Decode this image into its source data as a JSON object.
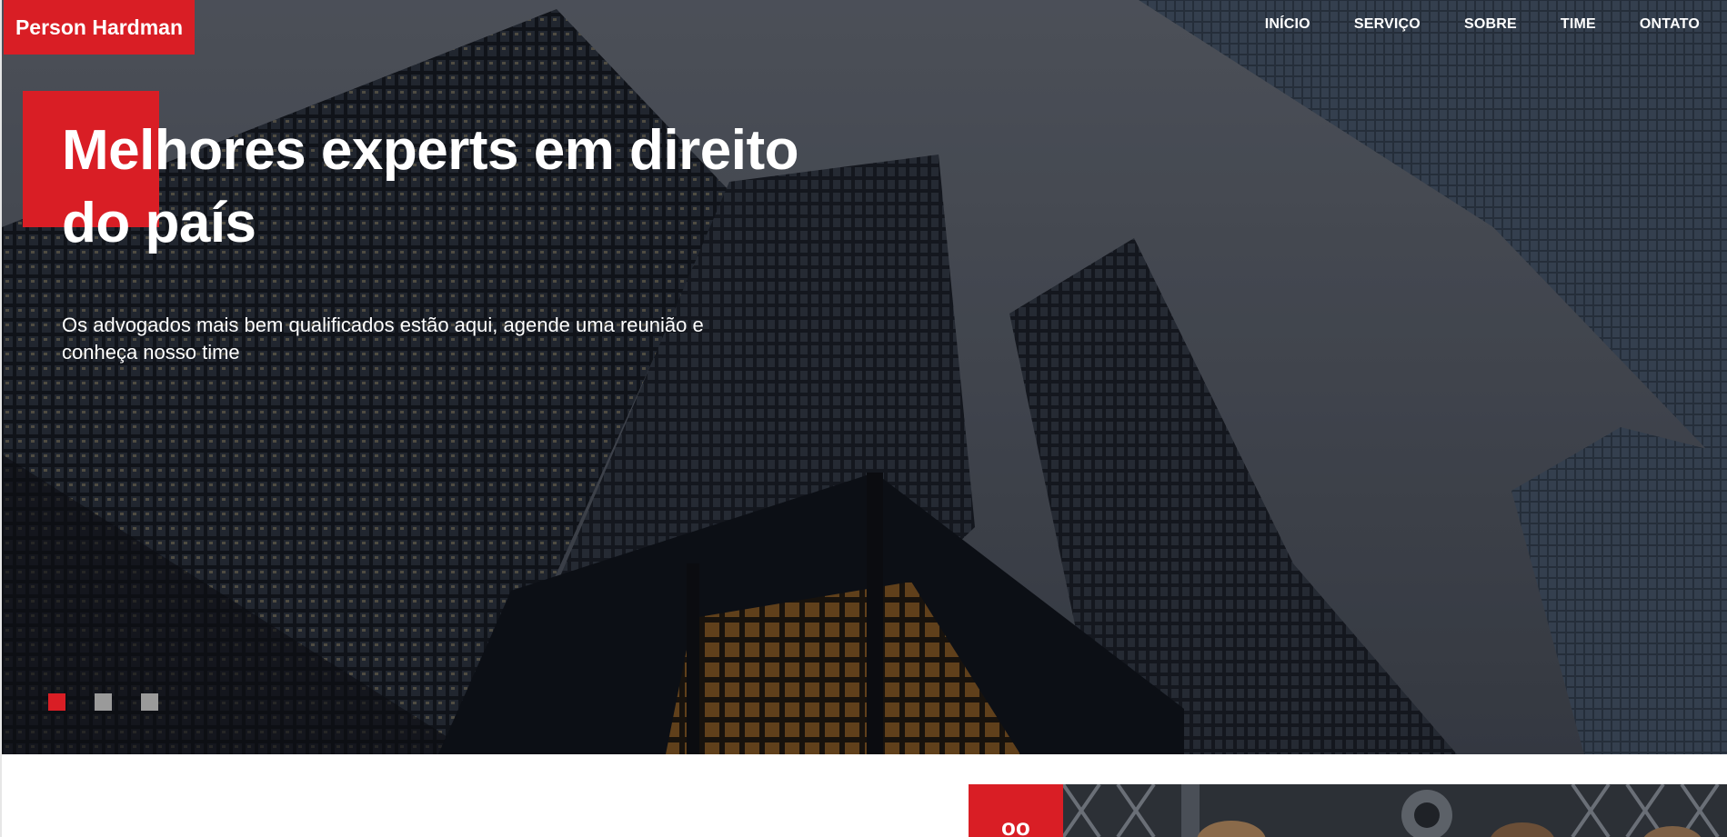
{
  "header": {
    "brand": "Person Hardman",
    "nav": [
      "INÍCIO",
      "SERVIÇO",
      "SOBRE",
      "TIME",
      "ONTATO"
    ]
  },
  "hero": {
    "headline": "Melhores experts em direito do país",
    "subtitle": "Os advogados mais bem qualificados estão aqui, agende uma reunião e conheça nosso time",
    "slides": {
      "count": 3,
      "active_index": 0
    }
  },
  "section": {
    "badge_icon": "quote-icon",
    "badge_glyph": "oo"
  },
  "colors": {
    "accent": "#d91e25",
    "text_light": "#ffffff",
    "dot_inactive": "#9a9a9a"
  }
}
